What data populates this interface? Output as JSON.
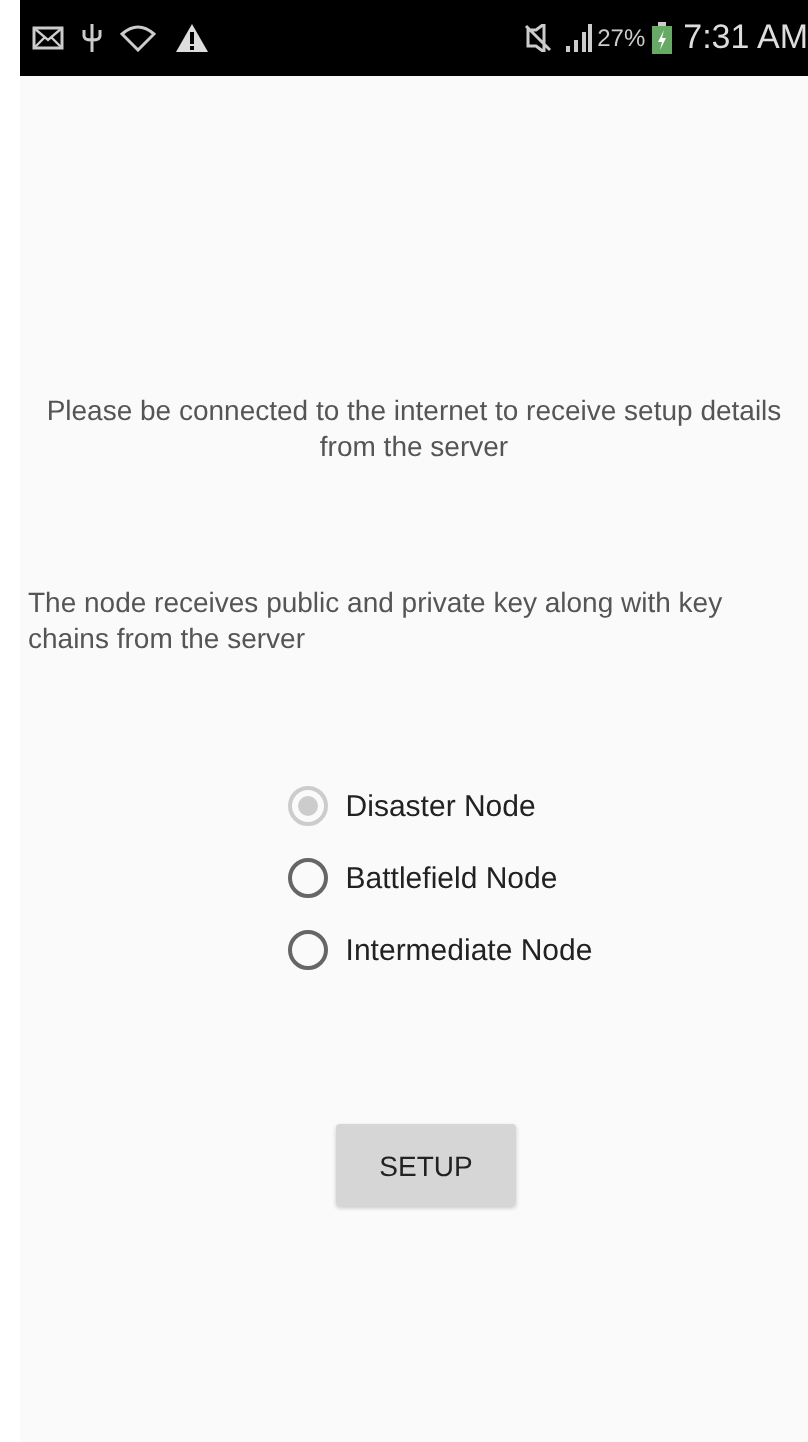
{
  "status_bar": {
    "battery": "27%",
    "time": "7:31 AM"
  },
  "messages": [
    "Please be connected to the internet to receive setup details from the server",
    "The node receives public and private key along with key chains from the server"
  ],
  "node_options": [
    {
      "label": "Disaster Node",
      "selected": true,
      "disabled": true
    },
    {
      "label": "Battlefield Node",
      "selected": false,
      "disabled": false
    },
    {
      "label": "Intermediate Node",
      "selected": false,
      "disabled": false
    }
  ],
  "button": "SETUP"
}
